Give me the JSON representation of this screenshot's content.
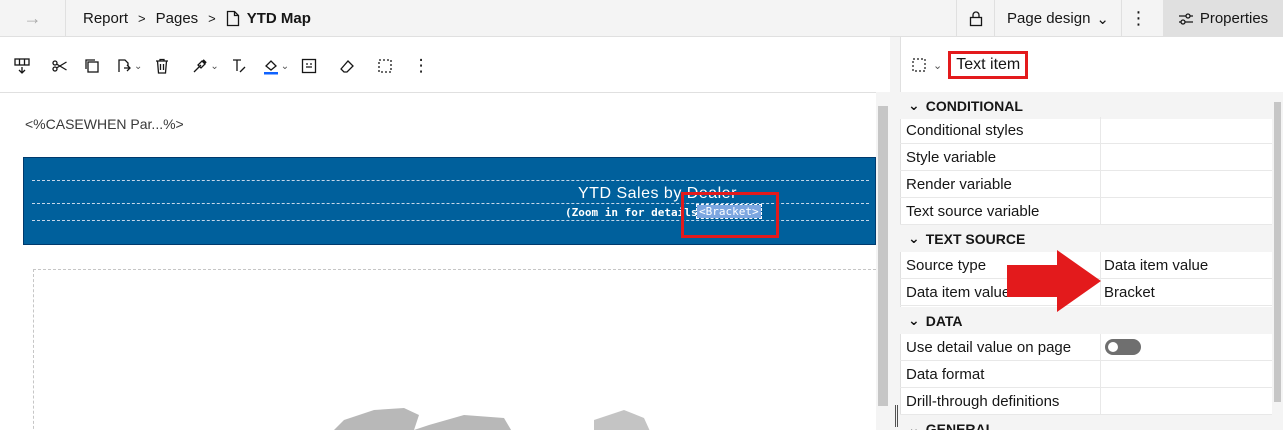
{
  "breadcrumb": {
    "items": [
      "Report",
      "Pages",
      "YTD Map"
    ]
  },
  "topbar": {
    "page_design_label": "Page design",
    "properties_label": "Properties"
  },
  "canvas": {
    "conditional_text": "<%CASEWHEN Par...%>",
    "header_title": "YTD Sales by Dealer",
    "header_subtitle": "(Zoom in for details)",
    "bracket_text": "<Bracket>"
  },
  "panel": {
    "object_type": "Text item",
    "sections": {
      "conditional": "CONDITIONAL",
      "text_source": "TEXT SOURCE",
      "data": "DATA",
      "general": "GENERAL"
    },
    "rows": {
      "conditional_styles": "Conditional styles",
      "style_variable": "Style variable",
      "render_variable": "Render variable",
      "text_source_variable": "Text source variable",
      "source_type": "Source type",
      "source_type_value": "Data item value",
      "data_item_value": "Data item value",
      "data_item_value_value": "Bracket",
      "use_detail_value": "Use detail value on page",
      "data_format": "Data format",
      "drill_through": "Drill-through definitions"
    },
    "use_detail_value_on": false
  },
  "colors": {
    "header_band": "#00609c",
    "highlight": "#e31a1c",
    "arrow": "#e31a1c"
  }
}
